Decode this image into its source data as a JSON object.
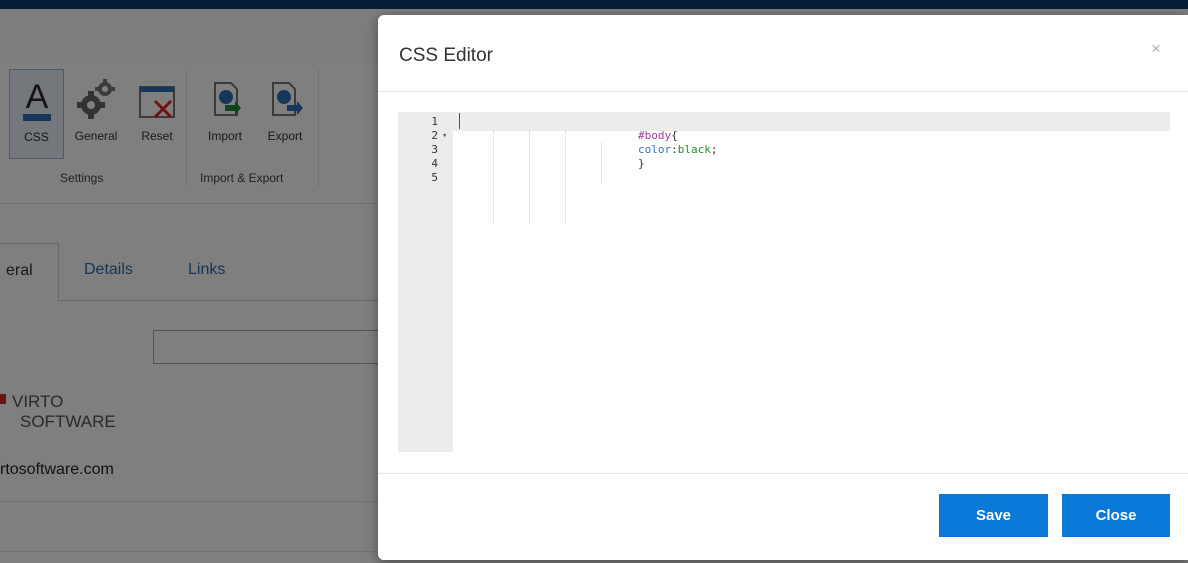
{
  "ribbon": {
    "buttons": [
      {
        "label": "CSS",
        "icon": "text-color-icon"
      },
      {
        "label": "General",
        "icon": "gears-icon"
      },
      {
        "label": "Reset",
        "icon": "reset-icon"
      },
      {
        "label": "Import",
        "icon": "import-icon"
      },
      {
        "label": "Export",
        "icon": "export-icon"
      }
    ],
    "groups": [
      "Settings",
      "Import & Export"
    ]
  },
  "tabs": [
    "eral",
    "Details",
    "Links"
  ],
  "logo": {
    "line1": "VIRTO",
    "line2": "SOFTWARE"
  },
  "site_text": "rtosoftware.com",
  "modal": {
    "title": "CSS Editor",
    "close_icon": "×",
    "editor": {
      "line_numbers": [
        "1",
        "2",
        "3",
        "4",
        "5"
      ],
      "fold_marker": "▾",
      "code": {
        "selector": "#body",
        "open_brace": "{",
        "property": "color",
        "colon": ":",
        "value": "black",
        "semicolon": ";",
        "close_brace": "}"
      }
    },
    "save_label": "Save",
    "close_label": "Close"
  },
  "colors": {
    "accent": "#0a78d6",
    "topbar": "#0b3c6f"
  }
}
